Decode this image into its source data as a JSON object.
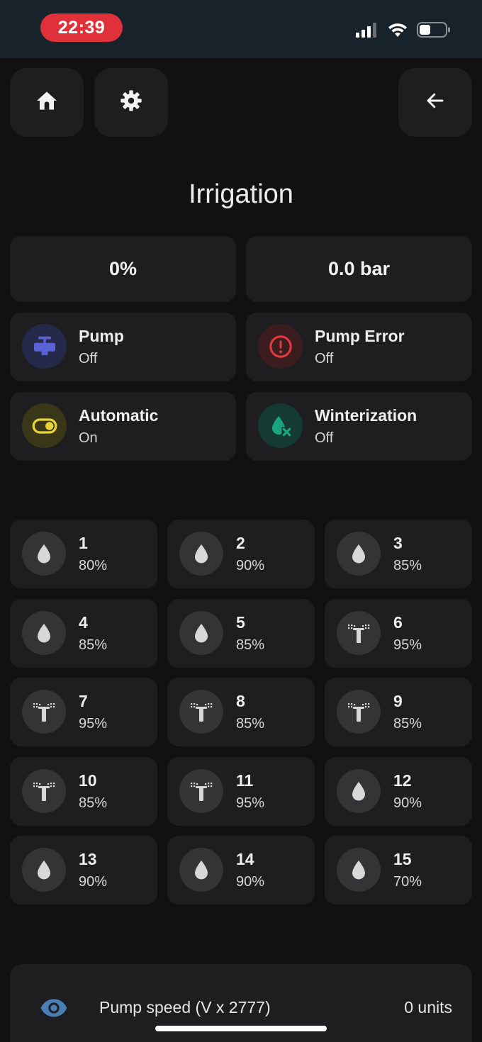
{
  "status_bar": {
    "time": "22:39"
  },
  "title": "Irrigation",
  "metrics": {
    "percent": "0%",
    "pressure": "0.0 bar"
  },
  "entities": [
    {
      "name": "Pump",
      "state": "Off",
      "icon": "valve-icon",
      "color": "#5b62d6",
      "bg": "#262a4a"
    },
    {
      "name": "Pump Error",
      "state": "Off",
      "icon": "alert-circle-icon",
      "color": "#e0393e",
      "bg": "#3b1d20"
    },
    {
      "name": "Automatic",
      "state": "On",
      "icon": "toggle-switch-icon",
      "color": "#e6d43a",
      "bg": "#3a3718"
    },
    {
      "name": "Winterization",
      "state": "Off",
      "icon": "water-off-icon",
      "color": "#19a57d",
      "bg": "#143a31"
    }
  ],
  "zones": [
    {
      "num": "1",
      "value": "80%",
      "icon": "water-drop-icon"
    },
    {
      "num": "2",
      "value": "90%",
      "icon": "water-drop-icon"
    },
    {
      "num": "3",
      "value": "85%",
      "icon": "water-drop-icon"
    },
    {
      "num": "4",
      "value": "85%",
      "icon": "water-drop-icon"
    },
    {
      "num": "5",
      "value": "85%",
      "icon": "water-drop-icon"
    },
    {
      "num": "6",
      "value": "95%",
      "icon": "sprinkler-icon"
    },
    {
      "num": "7",
      "value": "95%",
      "icon": "sprinkler-icon"
    },
    {
      "num": "8",
      "value": "85%",
      "icon": "sprinkler-icon"
    },
    {
      "num": "9",
      "value": "85%",
      "icon": "sprinkler-icon"
    },
    {
      "num": "10",
      "value": "85%",
      "icon": "sprinkler-icon"
    },
    {
      "num": "11",
      "value": "95%",
      "icon": "sprinkler-icon"
    },
    {
      "num": "12",
      "value": "90%",
      "icon": "water-drop-icon"
    },
    {
      "num": "13",
      "value": "90%",
      "icon": "water-drop-icon"
    },
    {
      "num": "14",
      "value": "90%",
      "icon": "water-drop-icon"
    },
    {
      "num": "15",
      "value": "70%",
      "icon": "water-drop-icon"
    }
  ],
  "pump_speed": {
    "label": "Pump speed (V x 2777)",
    "value": "0 units",
    "icon": "eye-icon",
    "icon_color": "#4a7fb5"
  }
}
